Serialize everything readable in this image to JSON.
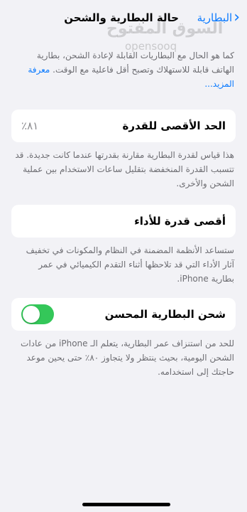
{
  "nav": {
    "back_label": "البطارية",
    "title": "حالة البطارية والشحن"
  },
  "watermark": {
    "main": "السوق المفتوح",
    "sub": "opensooq"
  },
  "intro": {
    "text": "كما هو الحال مع البطاريات القابلة لإعادة الشحن، بطارية الهاتف قابلة للاستهلاك وتصبح أقل فاعلية مع الوقت.",
    "link": "معرفة المزيد..."
  },
  "max_capacity": {
    "label": "الحد الأقصى للقدرة",
    "value": "٨١٪",
    "footnote": "هذا قياس لقدرة البطارية مقارنة بقدرتها عندما كانت جديدة. قد تتسبب القدرة المنخفضة بتقليل ساعات الاستخدام بين عملية الشحن والأخرى."
  },
  "peak_performance": {
    "label": "أقصى قدرة للأداء",
    "footnote": "ستساعد الأنظمة المضمنة في النظام والمكونات في تخفيف آثار الأداء التي قد تلاحظها أثناء التقدم الكيميائي في عمر بطارية iPhone."
  },
  "optimized_charging": {
    "label": "شحن البطارية المحسن",
    "enabled": true,
    "footnote": "للحد من استنزاف عمر البطارية، يتعلم الـ iPhone من عادات الشحن اليومية، بحيث ينتظر ولا يتجاوز ٨٠٪ حتى يحين موعد حاجتك إلى استخدامه."
  },
  "colors": {
    "accent": "#0a7aff",
    "toggle_on": "#34c759",
    "background": "#f2f2f6"
  }
}
